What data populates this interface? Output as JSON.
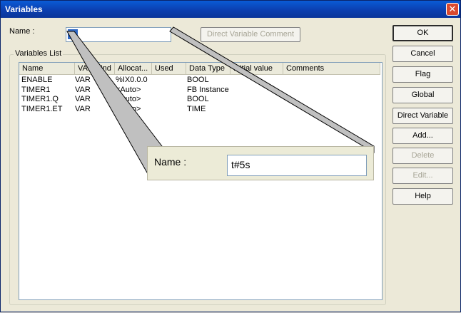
{
  "window": {
    "title": "Variables"
  },
  "name_field": {
    "label": "Name :",
    "value": "%"
  },
  "direct_variable_comment": {
    "label": "Direct Variable Comment"
  },
  "variables_list": {
    "label": "Variables List",
    "columns": [
      "Name",
      "VAR Kind",
      "Allocat...",
      "Used",
      "Data Type",
      "Initial value",
      "Comments"
    ],
    "rows": [
      {
        "name": "ENABLE",
        "kind": "VAR",
        "alloc": "%IX0.0.0",
        "used": "",
        "type": "BOOL"
      },
      {
        "name": "TIMER1",
        "kind": "VAR",
        "alloc": "<Auto>",
        "used": "",
        "type": "FB Instance"
      },
      {
        "name": "TIMER1.Q",
        "kind": "VAR",
        "alloc": "<Auto>",
        "used": "",
        "type": "BOOL"
      },
      {
        "name": "TIMER1.ET",
        "kind": "VAR",
        "alloc": "<Auto>",
        "used": "",
        "type": "TIME"
      }
    ]
  },
  "buttons": [
    {
      "id": "ok",
      "label": "OK",
      "enabled": true,
      "default": true
    },
    {
      "id": "cancel",
      "label": "Cancel",
      "enabled": true
    },
    {
      "id": "flag",
      "label": "Flag",
      "enabled": true
    },
    {
      "id": "global",
      "label": "Global",
      "enabled": true
    },
    {
      "id": "direct-variable",
      "label": "Direct Variable",
      "enabled": true
    },
    {
      "id": "add",
      "label": "Add...",
      "enabled": true
    },
    {
      "id": "delete",
      "label": "Delete",
      "enabled": false
    },
    {
      "id": "edit",
      "label": "Edit...",
      "enabled": false
    },
    {
      "id": "help",
      "label": "Help",
      "enabled": true
    }
  ],
  "zoom": {
    "label": "Name :",
    "value": "t#5s"
  },
  "colors": {
    "titlebar": "#0b3fb0",
    "selection": "#316ac5",
    "close": "#d9492f"
  }
}
